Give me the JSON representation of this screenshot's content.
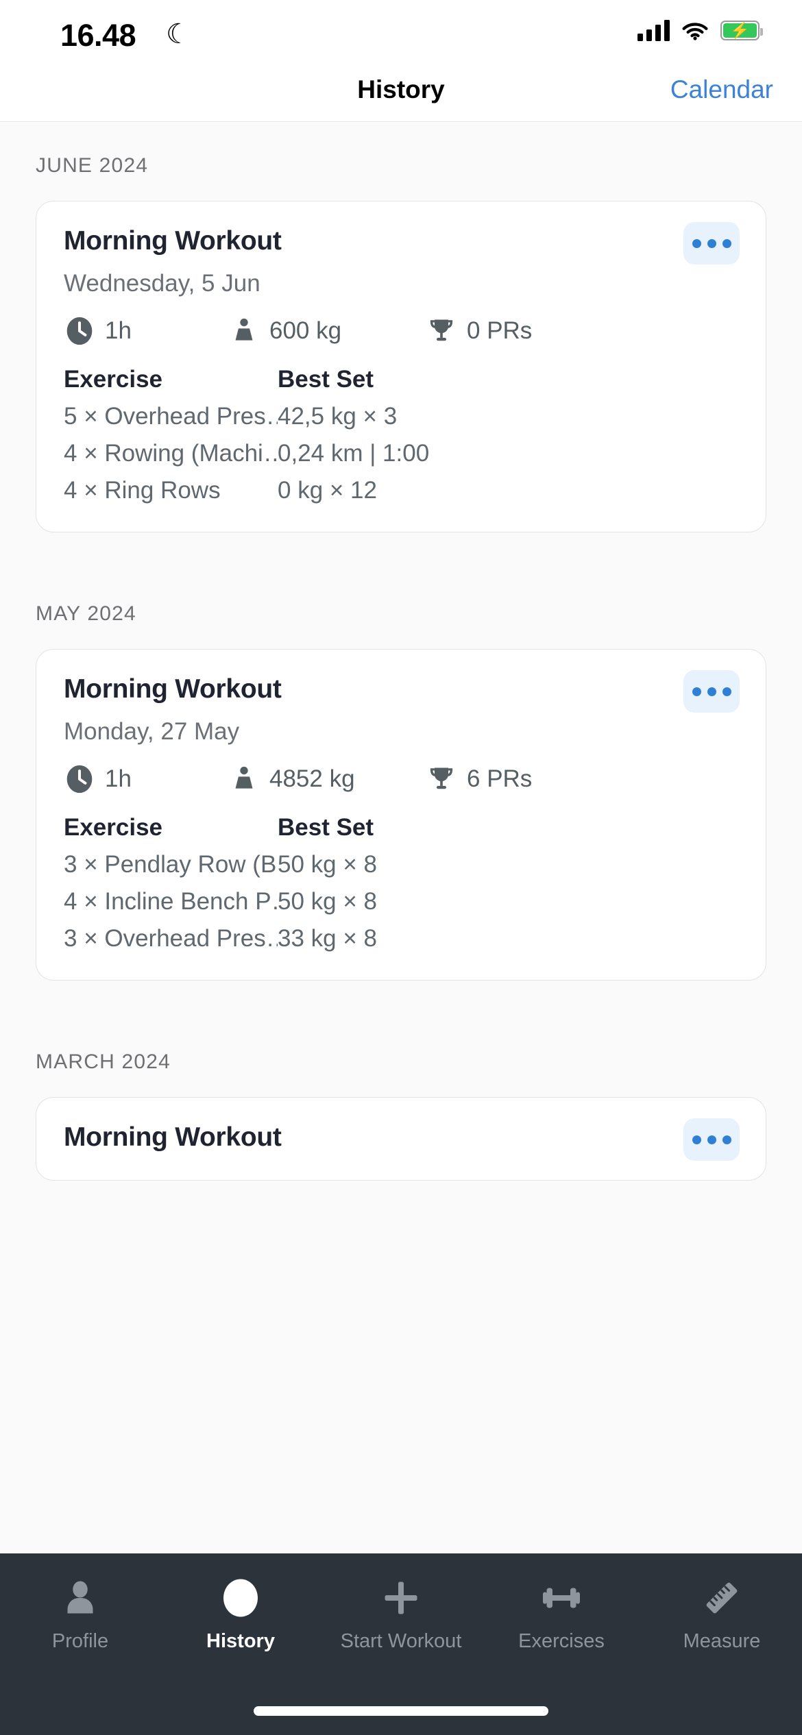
{
  "status_bar": {
    "time": "16.48",
    "moon_icon": "crescent-moon-icon",
    "signal_icon": "cellular-signal-icon",
    "wifi_icon": "wifi-icon",
    "battery_icon": "battery-charging-icon",
    "battery_color": "#34c759"
  },
  "navbar": {
    "title": "History",
    "action_label": "Calendar",
    "action_color": "#3b82d8"
  },
  "sections": [
    {
      "month": "JUNE 2024",
      "workouts": [
        {
          "title": "Morning Workout",
          "date": "Wednesday, 5 Jun",
          "more_label": "more-options",
          "stats": {
            "duration_icon": "clock-icon",
            "duration": "1h",
            "volume_icon": "weight-icon",
            "volume": "600 kg",
            "prs_icon": "trophy-icon",
            "prs": "0 PRs"
          },
          "table": {
            "col_exercise": "Exercise",
            "col_best_set": "Best Set",
            "rows": [
              {
                "exercise": "5 × Overhead Pres…",
                "best_set": "42,5 kg × 3"
              },
              {
                "exercise": "4 × Rowing (Machi…",
                "best_set": "0,24 km | 1:00"
              },
              {
                "exercise": "4 × Ring Rows",
                "best_set": "0 kg × 12"
              }
            ]
          }
        }
      ]
    },
    {
      "month": "MAY 2024",
      "workouts": [
        {
          "title": "Morning Workout",
          "date": "Monday, 27 May",
          "more_label": "more-options",
          "stats": {
            "duration_icon": "clock-icon",
            "duration": "1h",
            "volume_icon": "weight-icon",
            "volume": "4852 kg",
            "prs_icon": "trophy-icon",
            "prs": "6 PRs"
          },
          "table": {
            "col_exercise": "Exercise",
            "col_best_set": "Best Set",
            "rows": [
              {
                "exercise": "3 × Pendlay Row (B…",
                "best_set": "50 kg × 8"
              },
              {
                "exercise": "4 × Incline Bench P…",
                "best_set": "50 kg × 8"
              },
              {
                "exercise": "3 × Overhead Pres…",
                "best_set": "33 kg × 8"
              }
            ]
          }
        }
      ]
    },
    {
      "month": "MARCH 2024",
      "workouts": [
        {
          "title": "Morning Workout",
          "date": "",
          "more_label": "more-options",
          "stats": null,
          "table": null
        }
      ]
    }
  ],
  "tabbar": {
    "background": "#2d333b",
    "items": [
      {
        "icon": "person-icon",
        "label": "Profile",
        "active": false
      },
      {
        "icon": "clock-icon",
        "label": "History",
        "active": true
      },
      {
        "icon": "plus-icon",
        "label": "Start Workout",
        "active": false
      },
      {
        "icon": "dumbbell-icon",
        "label": "Exercises",
        "active": false
      },
      {
        "icon": "ruler-icon",
        "label": "Measure",
        "active": false
      }
    ]
  }
}
